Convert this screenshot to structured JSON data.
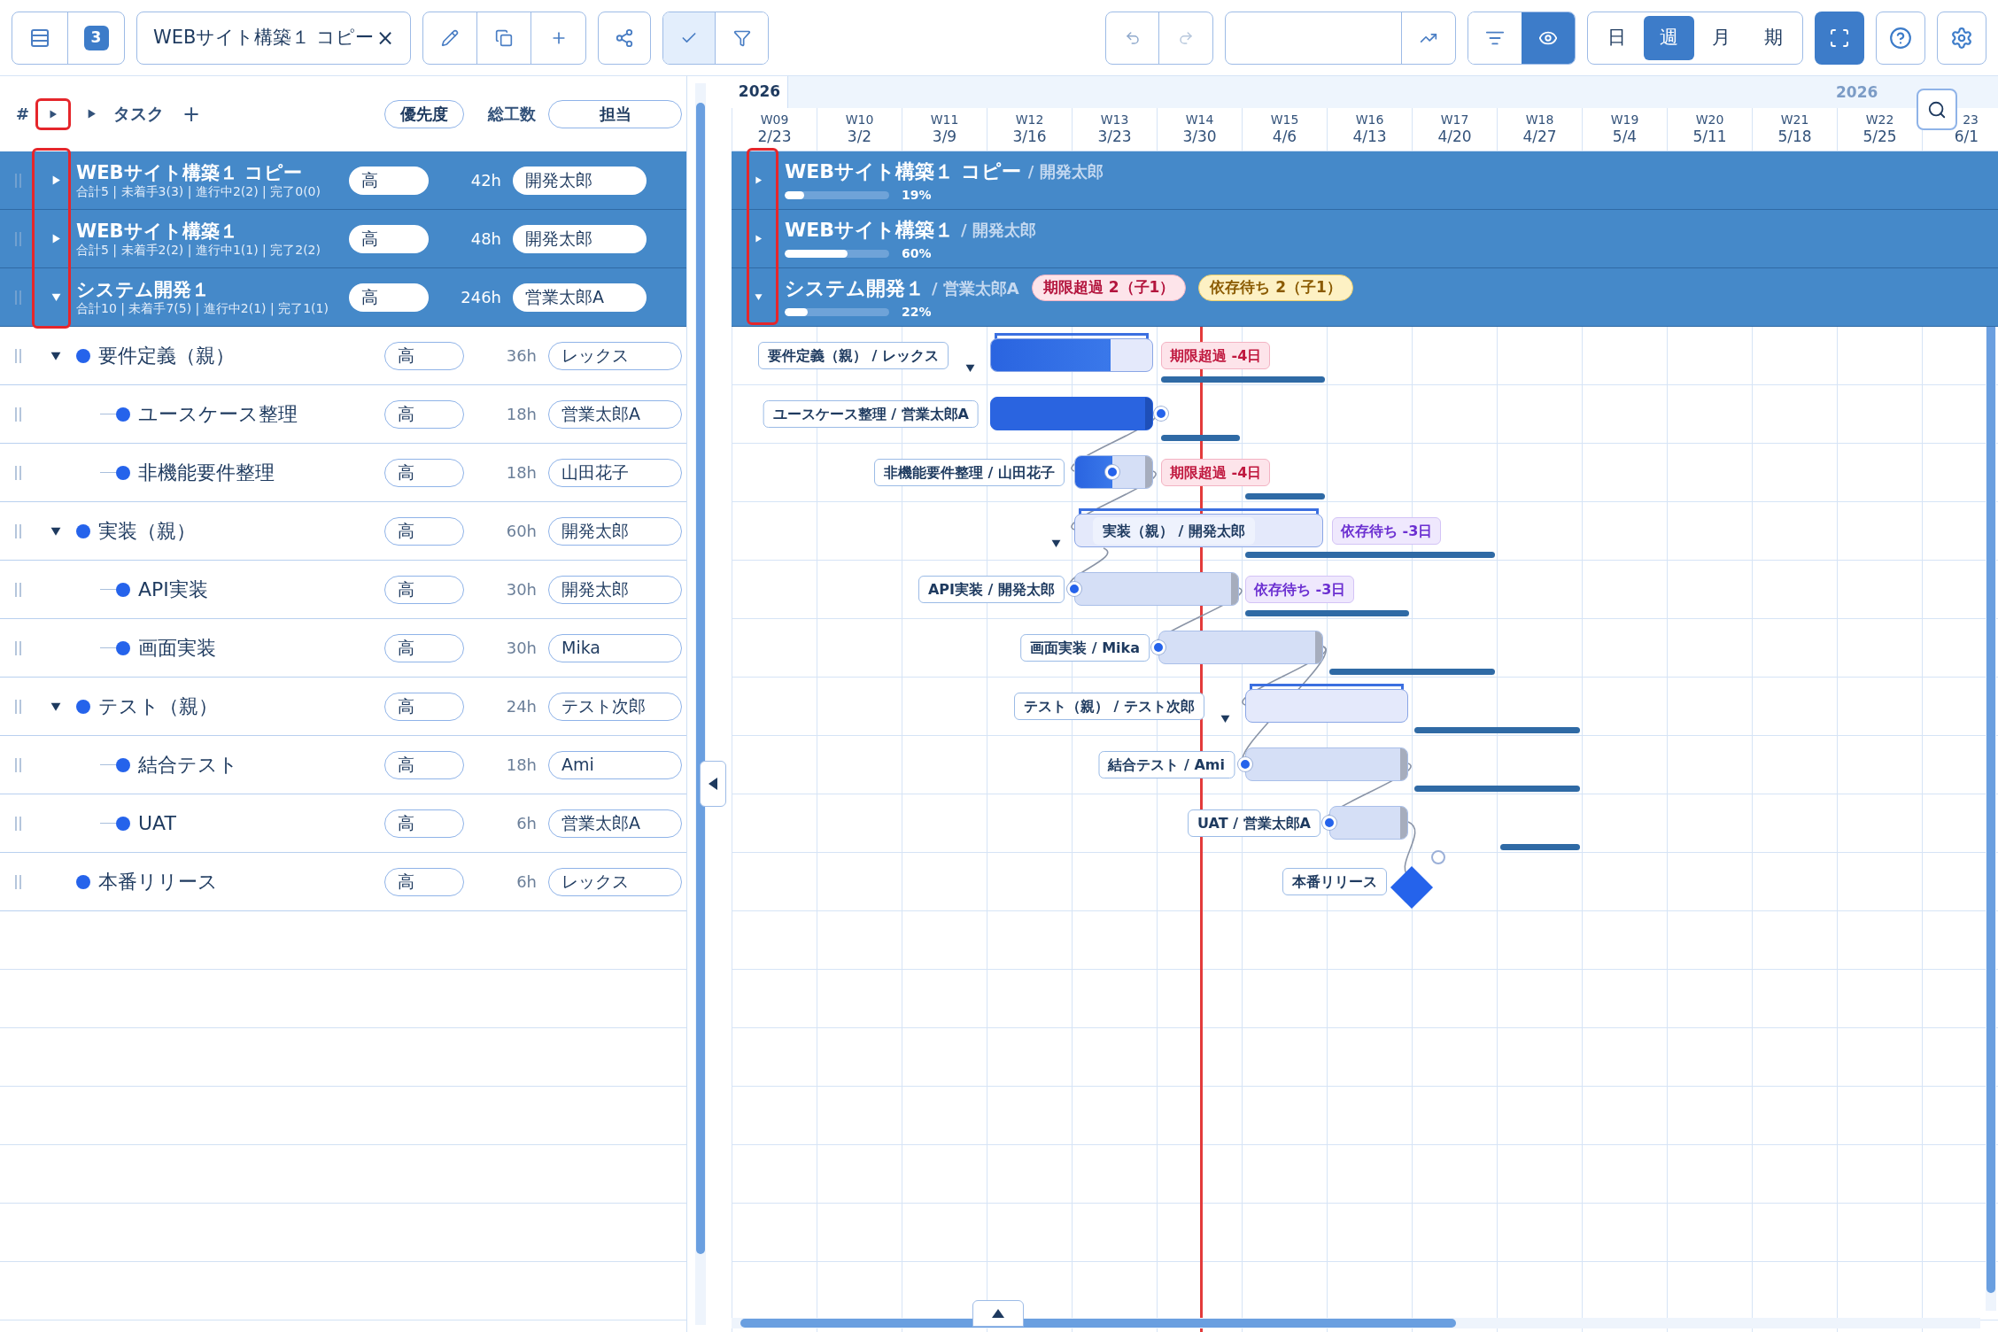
{
  "toolbar": {
    "count": "3",
    "tab": {
      "title": "WEBサイト構築１ コピー",
      "close": "×"
    },
    "toggles": [
      {
        "kind": "check",
        "on": true
      },
      {
        "kind": "filter",
        "on": false
      }
    ],
    "display": [
      {
        "kind": "list",
        "on": false
      },
      {
        "kind": "eye",
        "on": true
      }
    ],
    "view_modes": [
      {
        "label": "日",
        "selected": false
      },
      {
        "label": "週",
        "selected": true
      },
      {
        "label": "月",
        "selected": false
      },
      {
        "label": "期",
        "selected": false
      }
    ]
  },
  "task_list": {
    "columns": {
      "number": "#",
      "task": "タスク",
      "add": "+",
      "priority": "優先度",
      "hours": "総工数",
      "assignee": "担当"
    },
    "projects": [
      {
        "name": "WEBサイト構築１ コピー",
        "summary": "合計5 | 未着手3(3) | 進行中2(2) | 完了0(0)",
        "expanded": false,
        "priority": "高",
        "hours": "42h",
        "assignee": "開発太郎"
      },
      {
        "name": "WEBサイト構築１",
        "summary": "合計5 | 未着手2(2) | 進行中1(1) | 完了2(2)",
        "expanded": false,
        "priority": "高",
        "hours": "48h",
        "assignee": "開発太郎"
      },
      {
        "name": "システム開発１",
        "summary": "合計10 | 未着手7(5) | 進行中2(1) | 完了1(1)",
        "expanded": true,
        "priority": "高",
        "hours": "246h",
        "assignee": "営業太郎A"
      }
    ],
    "tasks": [
      {
        "name": "要件定義（親）",
        "expanded": true,
        "priority": "高",
        "hours": "36h",
        "assignee": "レックス",
        "children": [
          {
            "name": "ユースケース整理",
            "priority": "高",
            "hours": "18h",
            "assignee": "営業太郎A"
          },
          {
            "name": "非機能要件整理",
            "priority": "高",
            "hours": "18h",
            "assignee": "山田花子"
          }
        ]
      },
      {
        "name": "実装（親）",
        "expanded": true,
        "priority": "高",
        "hours": "60h",
        "assignee": "開発太郎",
        "children": [
          {
            "name": "API実装",
            "priority": "高",
            "hours": "30h",
            "assignee": "開発太郎"
          },
          {
            "name": "画面実装",
            "priority": "高",
            "hours": "30h",
            "assignee": "Mika"
          }
        ]
      },
      {
        "name": "テスト（親）",
        "expanded": true,
        "priority": "高",
        "hours": "24h",
        "assignee": "テスト次郎",
        "children": [
          {
            "name": "結合テスト",
            "priority": "高",
            "hours": "18h",
            "assignee": "Ami"
          },
          {
            "name": "UAT",
            "priority": "高",
            "hours": "6h",
            "assignee": "営業太郎A"
          }
        ]
      },
      {
        "name": "本番リリース",
        "priority": "高",
        "hours": "6h",
        "assignee": "レックス"
      }
    ]
  },
  "gantt": {
    "years": [
      "2026",
      "2026"
    ],
    "weeks": [
      {
        "week": "W09",
        "date": "2/23"
      },
      {
        "week": "W10",
        "date": "3/2"
      },
      {
        "week": "W11",
        "date": "3/9"
      },
      {
        "week": "W12",
        "date": "3/16"
      },
      {
        "week": "W13",
        "date": "3/23"
      },
      {
        "week": "W14",
        "date": "3/30"
      },
      {
        "week": "W15",
        "date": "4/6"
      },
      {
        "week": "W16",
        "date": "4/13"
      },
      {
        "week": "W17",
        "date": "4/20"
      },
      {
        "week": "W18",
        "date": "4/27"
      },
      {
        "week": "W19",
        "date": "5/4"
      },
      {
        "week": "W20",
        "date": "5/11"
      },
      {
        "week": "W21",
        "date": "5/18"
      },
      {
        "week": "W22",
        "date": "5/25"
      },
      {
        "week": "23",
        "date": "6/1"
      }
    ],
    "projects": [
      {
        "title": "WEBサイト構築１ コピー",
        "owner": "/ 開発太郎",
        "expanded": false,
        "level": 0.19,
        "reading": "19%"
      },
      {
        "title": "WEBサイト構築１",
        "owner": "/ 開発太郎",
        "expanded": false,
        "level": 0.6,
        "reading": "60%"
      },
      {
        "title": "システム開発１",
        "owner": "/ 営業太郎A",
        "expanded": true,
        "level": 0.22,
        "reading": "22%",
        "tags": [
          {
            "kind": "overdue",
            "label": "期限超過 2（子1）"
          },
          {
            "kind": "waiting",
            "label": "依存待ち 2（子1）"
          }
        ]
      }
    ],
    "rows": [
      {
        "kind": "summary",
        "label": "要件定義（親） / レックス",
        "expanded": true,
        "level": 0.74,
        "tags": [
          {
            "kind": "overdue",
            "label": "期限超過 -4日"
          }
        ]
      },
      {
        "kind": "task",
        "label": "ユースケース整理 / 営業太郎A",
        "level": 1
      },
      {
        "kind": "task",
        "label": "非機能要件整理 / 山田花子",
        "level": 0.48,
        "tags": [
          {
            "kind": "overdue",
            "label": "期限超過 -4日"
          }
        ]
      },
      {
        "kind": "summary",
        "label": "実装（親） / 開発太郎",
        "expanded": true,
        "tags": [
          {
            "kind": "waiting",
            "label": "依存待ち -3日"
          }
        ]
      },
      {
        "kind": "task",
        "label": "API実装 / 開発太郎",
        "tags": [
          {
            "kind": "waiting",
            "label": "依存待ち -3日"
          }
        ]
      },
      {
        "kind": "task",
        "label": "画面実装 / Mika"
      },
      {
        "kind": "summary",
        "label": "テスト（親） / テスト次郎",
        "expanded": true
      },
      {
        "kind": "task",
        "label": "結合テスト / Ami"
      },
      {
        "kind": "task",
        "label": "UAT / 営業太郎A"
      },
      {
        "kind": "milestone",
        "label": "本番リリース"
      }
    ]
  }
}
